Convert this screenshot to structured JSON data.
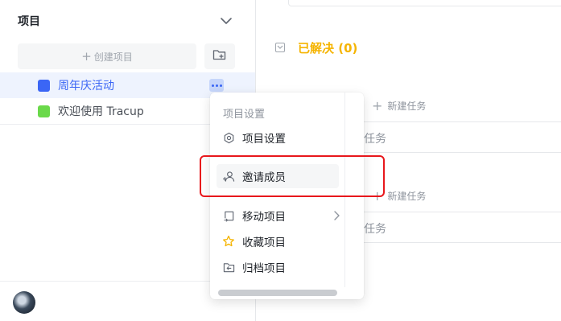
{
  "sidebar": {
    "title": "项目",
    "create_label": "创建项目",
    "projects": [
      {
        "name": "周年庆活动",
        "color": "#3b66f5",
        "active": true
      },
      {
        "name": "欢迎使用 Tracup",
        "color": "#6ad94a",
        "active": false
      }
    ]
  },
  "main": {
    "section_title": "已解决 (0)",
    "new_task_label": "新建任务",
    "task_text": "任务"
  },
  "menu": {
    "header": "项目设置",
    "items": [
      {
        "label": "项目设置",
        "icon": "settings-icon"
      },
      {
        "label": "邀请成员",
        "icon": "invite-user-icon"
      },
      {
        "label": "移动项目",
        "icon": "move-icon"
      },
      {
        "label": "收藏项目",
        "icon": "star-icon"
      },
      {
        "label": "归档项目",
        "icon": "archive-icon"
      }
    ]
  },
  "colors": {
    "accent": "#3b66f5",
    "resolved_title": "#f5b400",
    "star": "#f5b400",
    "highlight": "#e8171c"
  }
}
